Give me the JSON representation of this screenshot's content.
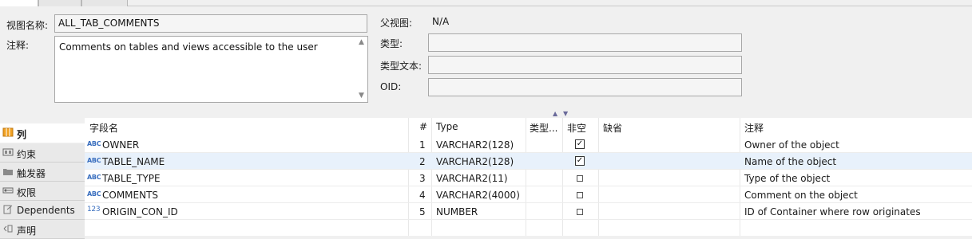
{
  "form": {
    "view_name_label": "视图名称:",
    "view_name_value": "ALL_TAB_COMMENTS",
    "comment_label": "注释:",
    "comment_value": "Comments on tables and views accessible to the user",
    "parent_view_label": "父视图:",
    "parent_view_value": "N/A",
    "type_label": "类型:",
    "type_value": "",
    "type_text_label": "类型文本:",
    "type_text_value": "",
    "oid_label": "OID:",
    "oid_value": ""
  },
  "sidebar": {
    "items": [
      {
        "label": "列",
        "icon": "columns-icon",
        "active": true
      },
      {
        "label": "约束",
        "icon": "constraint-icon",
        "active": false
      },
      {
        "label": "触发器",
        "icon": "folder-icon",
        "active": false
      },
      {
        "label": "权限",
        "icon": "key-icon",
        "active": false
      },
      {
        "label": "Dependents",
        "icon": "dependency-icon",
        "active": false
      },
      {
        "label": "声明",
        "icon": "declaration-icon",
        "active": false
      }
    ]
  },
  "grid": {
    "columns": [
      "字段名",
      "#",
      "Type",
      "类型...",
      "非空",
      "缺省",
      "注释"
    ],
    "rows": [
      {
        "type_icon": "ABC",
        "name": "OWNER",
        "num": "1",
        "type": "VARCHAR2(128)",
        "not_null": true,
        "comment": "Owner of the object"
      },
      {
        "type_icon": "ABC",
        "name": "TABLE_NAME",
        "num": "2",
        "type": "VARCHAR2(128)",
        "not_null": true,
        "comment": "Name of the object",
        "selected": true
      },
      {
        "type_icon": "ABC",
        "name": "TABLE_TYPE",
        "num": "3",
        "type": "VARCHAR2(11)",
        "not_null": false,
        "comment": "Type of the object"
      },
      {
        "type_icon": "ABC",
        "name": "COMMENTS",
        "num": "4",
        "type": "VARCHAR2(4000)",
        "not_null": false,
        "comment": "Comment on the object"
      },
      {
        "type_icon": "123",
        "name": "ORIGIN_CON_ID",
        "num": "5",
        "type": "NUMBER",
        "not_null": false,
        "comment": "ID of Container where row originates"
      }
    ]
  },
  "colors": {
    "selected_row": "#e8f1fb",
    "type_icon": "#3a6fbf",
    "active_tab_icon": "#f0a020"
  }
}
